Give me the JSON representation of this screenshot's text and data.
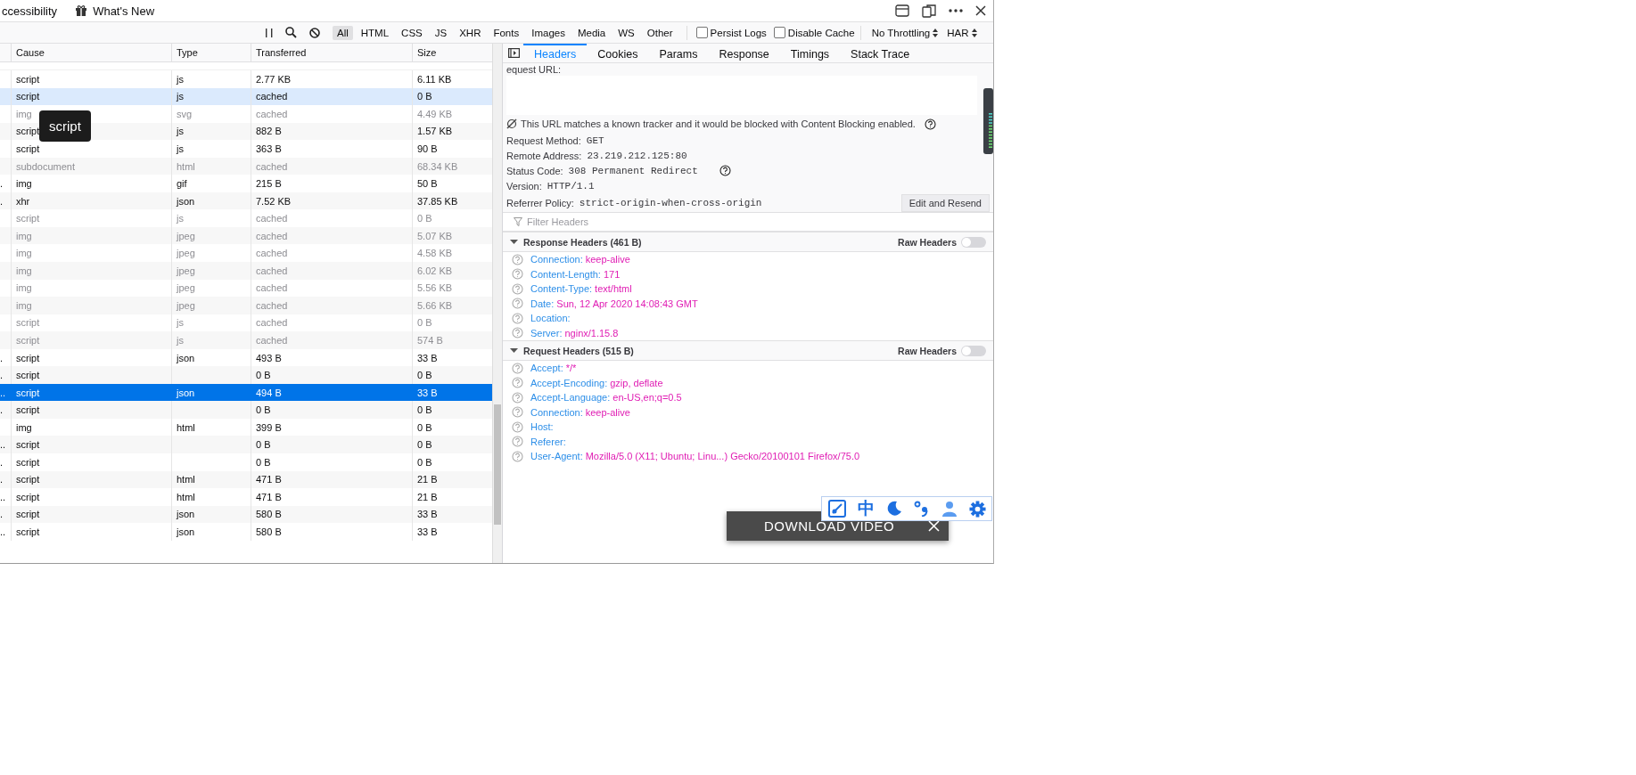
{
  "top_bar": {
    "items": [
      {
        "label": "ccessibility",
        "kind": "plain"
      },
      {
        "label": "What's New",
        "kind": "gift"
      }
    ]
  },
  "toolbar": {
    "filters": [
      {
        "label": "All",
        "selected": true
      },
      {
        "label": "HTML",
        "selected": false
      },
      {
        "label": "CSS",
        "selected": false
      },
      {
        "label": "JS",
        "selected": false
      },
      {
        "label": "XHR",
        "selected": false
      },
      {
        "label": "Fonts",
        "selected": false
      },
      {
        "label": "Images",
        "selected": false
      },
      {
        "label": "Media",
        "selected": false
      },
      {
        "label": "WS",
        "selected": false
      },
      {
        "label": "Other",
        "selected": false
      }
    ],
    "checkboxes": [
      {
        "label": "Persist Logs",
        "checked": false
      },
      {
        "label": "Disable Cache",
        "checked": false
      }
    ],
    "throttling": "No Throttling",
    "har": "HAR"
  },
  "table": {
    "columns": [
      "Cause",
      "Type",
      "Transferred",
      "Size"
    ],
    "rows": [
      {
        "cause": "script",
        "type": "js",
        "transferred": "2.77 KB",
        "size": "6.11 KB",
        "dimmed": false,
        "hovered": false,
        "selected": false
      },
      {
        "cause": "script",
        "type": "js",
        "transferred": "cached",
        "size": "0 B",
        "dimmed": false,
        "hovered": true,
        "selected": false
      },
      {
        "cause": "img",
        "type": "svg",
        "transferred": "cached",
        "size": "4.49 KB",
        "dimmed": true,
        "hovered": false,
        "selected": false
      },
      {
        "cause": "script",
        "type": "js",
        "transferred": "882 B",
        "size": "1.57 KB",
        "dimmed": false,
        "hovered": false,
        "selected": false
      },
      {
        "cause": "script",
        "type": "js",
        "transferred": "363 B",
        "size": "90 B",
        "dimmed": false,
        "hovered": false,
        "selected": false
      },
      {
        "cause": "subdocument",
        "type": "html",
        "transferred": "cached",
        "size": "68.34 KB",
        "dimmed": true,
        "hovered": false,
        "selected": false
      },
      {
        "column_1": ".",
        "cause": "img",
        "type": "gif",
        "transferred": "215 B",
        "size": "50 B",
        "dimmed": false,
        "hovered": false,
        "selected": false
      },
      {
        "column_1": ".",
        "cause": "xhr",
        "type": "json",
        "transferred": "7.52 KB",
        "size": "37.85 KB",
        "dimmed": false,
        "hovered": false,
        "selected": false
      },
      {
        "cause": "script",
        "type": "js",
        "transferred": "cached",
        "size": "0 B",
        "dimmed": true,
        "hovered": false,
        "selected": false
      },
      {
        "cause": "img",
        "type": "jpeg",
        "transferred": "cached",
        "size": "5.07 KB",
        "dimmed": true,
        "hovered": false,
        "selected": false
      },
      {
        "cause": "img",
        "type": "jpeg",
        "transferred": "cached",
        "size": "4.58 KB",
        "dimmed": true,
        "hovered": false,
        "selected": false
      },
      {
        "cause": "img",
        "type": "jpeg",
        "transferred": "cached",
        "size": "6.02 KB",
        "dimmed": true,
        "hovered": false,
        "selected": false
      },
      {
        "cause": "img",
        "type": "jpeg",
        "transferred": "cached",
        "size": "5.56 KB",
        "dimmed": true,
        "hovered": false,
        "selected": false
      },
      {
        "cause": "img",
        "type": "jpeg",
        "transferred": "cached",
        "size": "5.66 KB",
        "dimmed": true,
        "hovered": false,
        "selected": false
      },
      {
        "cause": "script",
        "type": "js",
        "transferred": "cached",
        "size": "0 B",
        "dimmed": true,
        "hovered": false,
        "selected": false
      },
      {
        "cause": "script",
        "type": "js",
        "transferred": "cached",
        "size": "574 B",
        "dimmed": true,
        "hovered": false,
        "selected": false
      },
      {
        "column_1": ".",
        "cause": "script",
        "type": "json",
        "transferred": "493 B",
        "size": "33 B",
        "dimmed": false,
        "hovered": false,
        "selected": false
      },
      {
        "column_1": ".",
        "cause": "script",
        "transferred": "0 B",
        "size": "0 B",
        "dimmed": false,
        "hovered": false,
        "selected": false
      },
      {
        "column_1": "..",
        "cause": "script",
        "type": "json",
        "transferred": "494 B",
        "size": "33 B",
        "dimmed": false,
        "hovered": false,
        "selected": true
      },
      {
        "column_1": ".",
        "cause": "script",
        "transferred": "0 B",
        "size": "0 B",
        "dimmed": false,
        "hovered": false,
        "selected": false
      },
      {
        "cause": "img",
        "type": "html",
        "transferred": "399 B",
        "size": "0 B",
        "dimmed": false,
        "hovered": false,
        "selected": false
      },
      {
        "column_1": "..",
        "cause": "script",
        "transferred": "0 B",
        "size": "0 B",
        "dimmed": false,
        "hovered": false,
        "selected": false
      },
      {
        "column_1": ".",
        "cause": "script",
        "transferred": "0 B",
        "size": "0 B",
        "dimmed": false,
        "hovered": false,
        "selected": false
      },
      {
        "column_1": ".",
        "cause": "script",
        "type": "html",
        "transferred": "471 B",
        "size": "21 B",
        "dimmed": false,
        "hovered": false,
        "selected": false
      },
      {
        "column_1": "..",
        "cause": "script",
        "type": "html",
        "transferred": "471 B",
        "size": "21 B",
        "dimmed": false,
        "hovered": false,
        "selected": false
      },
      {
        "column_1": ".",
        "cause": "script",
        "type": "json",
        "transferred": "580 B",
        "size": "33 B",
        "dimmed": false,
        "hovered": false,
        "selected": false
      },
      {
        "column_1": "..",
        "cause": "script",
        "type": "json",
        "transferred": "580 B",
        "size": "33 B",
        "dimmed": false,
        "hovered": false,
        "selected": false
      }
    ]
  },
  "tooltip": "script",
  "details": {
    "tabs": [
      {
        "label": "Headers",
        "selected": true
      },
      {
        "label": "Cookies",
        "selected": false
      },
      {
        "label": "Params",
        "selected": false
      },
      {
        "label": "Response",
        "selected": false
      },
      {
        "label": "Timings",
        "selected": false
      },
      {
        "label": "Stack Trace",
        "selected": false
      }
    ],
    "request_url_label": "equest URL:",
    "tracker_note": "This URL matches a known tracker and it would be blocked with Content Blocking enabled.",
    "fields": [
      {
        "label": "Request Method:",
        "value": "GET",
        "kind": "plain"
      },
      {
        "label": "Remote Address:",
        "value": "23.219.212.125:80",
        "kind": "plain"
      },
      {
        "label": "Status Code:",
        "value": "308 Permanent Redirect",
        "kind": "help"
      },
      {
        "label": "Version:",
        "value": "HTTP/1.1",
        "kind": "plain"
      },
      {
        "label": "Referrer Policy:",
        "value": "strict-origin-when-cross-origin",
        "kind": "plain"
      }
    ],
    "edit_button": "Edit and Resend",
    "filter_placeholder": "Filter Headers",
    "sections": [
      {
        "title": "Response Headers (461 B)",
        "expanded": true,
        "raw_label": "Raw Headers",
        "raw_on": false,
        "headers": [
          {
            "name": "Connection:",
            "value": "keep-alive"
          },
          {
            "name": "Content-Length:",
            "value": "171"
          },
          {
            "name": "Content-Type:",
            "value": "text/html"
          },
          {
            "name": "Date:",
            "value": "Sun, 12 Apr 2020 14:08:43 GMT"
          },
          {
            "name": "Location:"
          },
          {
            "name": "Server:",
            "value": "nginx/1.15.8"
          }
        ]
      },
      {
        "title": "Request Headers (515 B)",
        "expanded": true,
        "raw_label": "Raw Headers",
        "raw_on": false,
        "headers": [
          {
            "name": "Accept:",
            "value": "*/*"
          },
          {
            "name": "Accept-Encoding:",
            "value": "gzip, deflate"
          },
          {
            "name": "Accept-Language:",
            "value": "en-US,en;q=0.5"
          },
          {
            "name": "Connection:",
            "value": "keep-alive"
          },
          {
            "name": "Host:"
          },
          {
            "name": "Referer:"
          },
          {
            "name": "User-Agent:",
            "value": "Mozilla/5.0 (X11; Ubuntu; Linu...) Gecko/20100101 Firefox/75.0"
          }
        ]
      }
    ]
  },
  "floating_toolbar": {
    "chinese_button": "中"
  },
  "download_bar": {
    "label": "DOWNLOAD VIDEO"
  }
}
